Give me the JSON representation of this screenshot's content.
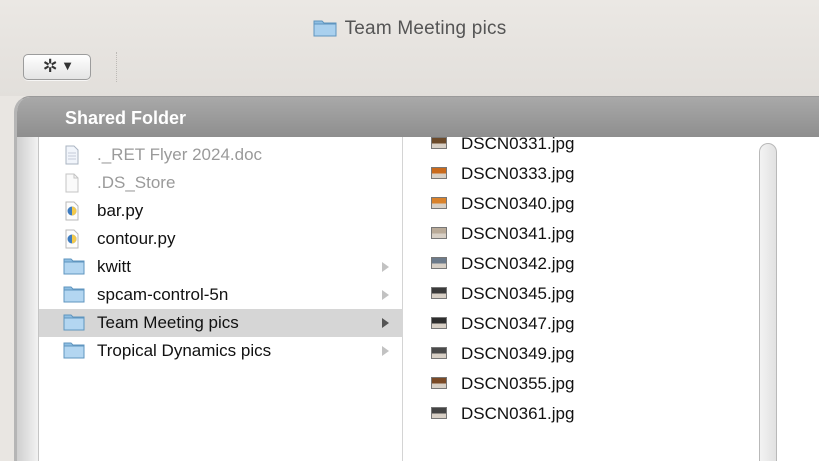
{
  "window": {
    "title": "Team Meeting pics"
  },
  "toolbar": {
    "action_icon": "gear-icon",
    "dropdown_icon": "chevron-down-icon"
  },
  "browser": {
    "header": "Shared Folder"
  },
  "column_one": {
    "items": [
      {
        "label": "._RET Flyer 2024.doc",
        "icon": "document-icon",
        "dim": true,
        "arrow": false
      },
      {
        "label": ".DS_Store",
        "icon": "blank-file-icon",
        "dim": true,
        "arrow": false
      },
      {
        "label": "bar.py",
        "icon": "python-file-icon",
        "dim": false,
        "arrow": false
      },
      {
        "label": "contour.py",
        "icon": "python-file-icon",
        "dim": false,
        "arrow": false
      },
      {
        "label": "kwitt",
        "icon": "folder-icon",
        "dim": false,
        "arrow": true
      },
      {
        "label": "spcam-control-5n",
        "icon": "folder-icon",
        "dim": false,
        "arrow": true
      },
      {
        "label": "Team Meeting pics",
        "icon": "folder-icon",
        "dim": false,
        "arrow": true,
        "selected": true
      },
      {
        "label": "Tropical Dynamics pics",
        "icon": "folder-icon",
        "dim": false,
        "arrow": true
      }
    ]
  },
  "column_two": {
    "items": [
      {
        "label": "DSCN0331.jpg",
        "color": "#6b4a2a"
      },
      {
        "label": "DSCN0333.jpg",
        "color": "#c96a1c"
      },
      {
        "label": "DSCN0340.jpg",
        "color": "#d9822b"
      },
      {
        "label": "DSCN0341.jpg",
        "color": "#b9aa98"
      },
      {
        "label": "DSCN0342.jpg",
        "color": "#6c7a8a"
      },
      {
        "label": "DSCN0345.jpg",
        "color": "#3a3a3a"
      },
      {
        "label": "DSCN0347.jpg",
        "color": "#2e2e2e"
      },
      {
        "label": "DSCN0349.jpg",
        "color": "#4a4a4a"
      },
      {
        "label": "DSCN0355.jpg",
        "color": "#7a4a26"
      },
      {
        "label": "DSCN0361.jpg",
        "color": "#444444"
      }
    ]
  },
  "colors": {
    "header_bg": "#999999",
    "selection": "#d6d6d6",
    "folder": "#7fb2da"
  }
}
